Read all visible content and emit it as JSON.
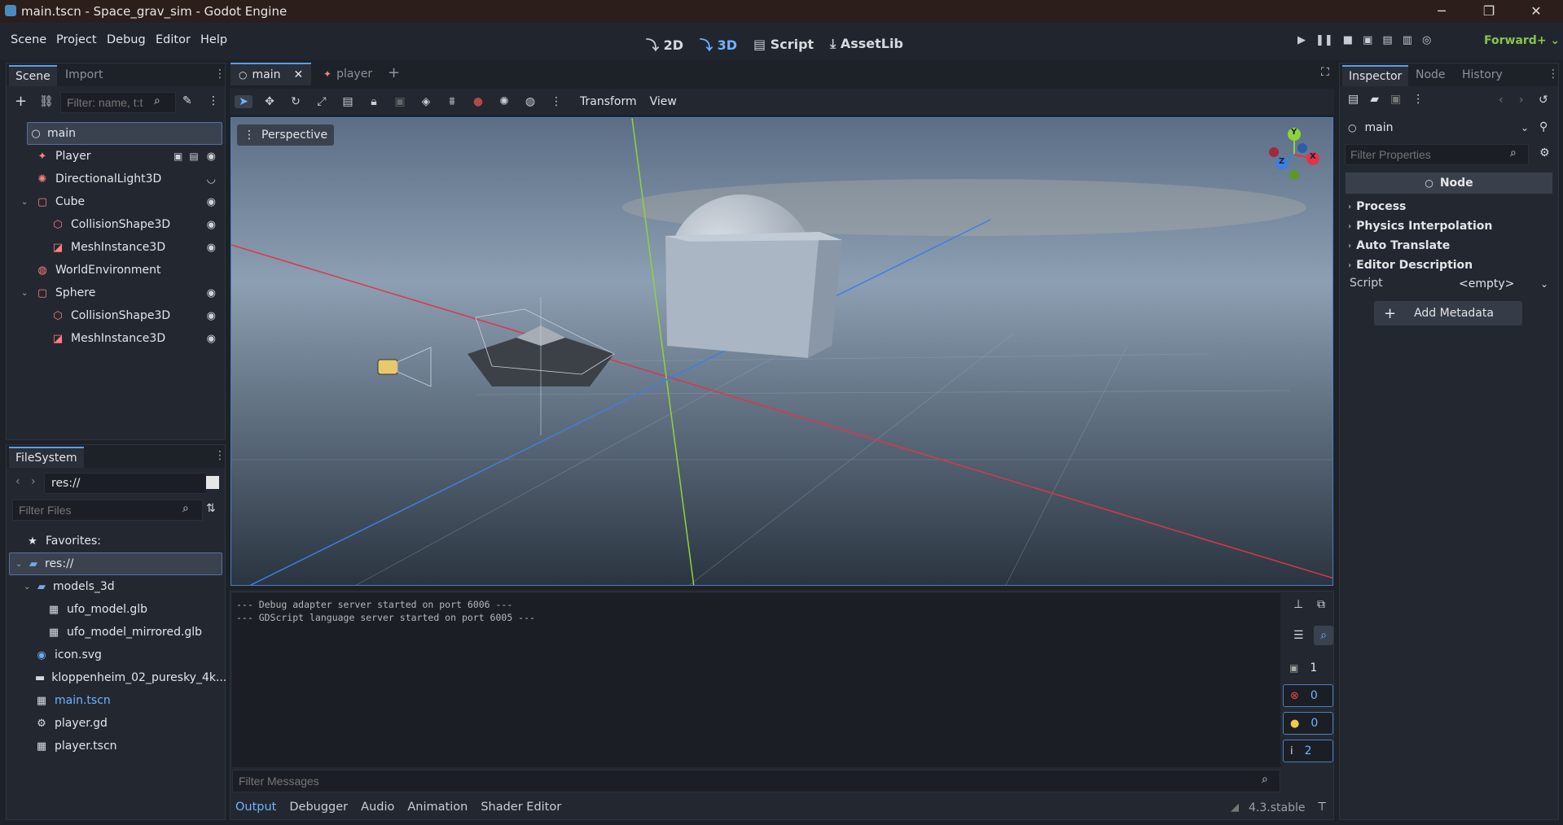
{
  "window": {
    "title": "main.tscn - Space_grav_sim - Godot Engine",
    "controls": [
      "─",
      "❐",
      "✕"
    ]
  },
  "menubar": {
    "menus": [
      "Scene",
      "Project",
      "Debug",
      "Editor",
      "Help"
    ],
    "modes": {
      "m2d": "2D",
      "m3d": "3D",
      "script": "Script",
      "assetlib": "AssetLib"
    },
    "renderer": "Forward+"
  },
  "scene_dock": {
    "tabs": {
      "scene": "Scene",
      "import": "Import"
    },
    "filter_placeholder": "Filter: name, t:t",
    "nodes": [
      {
        "label": "main",
        "icon": "○",
        "color": "#e0e0e0",
        "indent": 0,
        "expanded": true,
        "selected": true
      },
      {
        "label": "Player",
        "icon": "✦",
        "color": "#fc7f7f",
        "indent": 1
      },
      {
        "label": "DirectionalLight3D",
        "icon": "✺",
        "color": "#fc7f7f",
        "indent": 1
      },
      {
        "label": "Cube",
        "icon": "▢",
        "color": "#fc7f7f",
        "indent": 1,
        "expanded": true
      },
      {
        "label": "CollisionShape3D",
        "icon": "⬡",
        "color": "#fc7f7f",
        "indent": 2
      },
      {
        "label": "MeshInstance3D",
        "icon": "◪",
        "color": "#fc7f7f",
        "indent": 2
      },
      {
        "label": "WorldEnvironment",
        "icon": "◍",
        "color": "#fc7f7f",
        "indent": 1
      },
      {
        "label": "Sphere",
        "icon": "▢",
        "color": "#fc7f7f",
        "indent": 1,
        "expanded": true
      },
      {
        "label": "CollisionShape3D",
        "icon": "⬡",
        "color": "#fc7f7f",
        "indent": 2
      },
      {
        "label": "MeshInstance3D",
        "icon": "◪",
        "color": "#fc7f7f",
        "indent": 2
      }
    ]
  },
  "filesystem": {
    "tab": "FileSystem",
    "path": "res://",
    "filter_placeholder": "Filter Files",
    "items": [
      {
        "label": "Favorites:",
        "icon": "★",
        "indent": 0
      },
      {
        "label": "res://",
        "icon": "▰",
        "indent": 0,
        "expanded": true,
        "selected": true
      },
      {
        "label": "models_3d",
        "icon": "▰",
        "indent": 1,
        "expanded": true
      },
      {
        "label": "ufo_model.glb",
        "icon": "▦",
        "indent": 2
      },
      {
        "label": "ufo_model_mirrored.glb",
        "icon": "▦",
        "indent": 2
      },
      {
        "label": "icon.svg",
        "icon": "◉",
        "indent": 1
      },
      {
        "label": "kloppenheim_02_puresky_4k...",
        "icon": "▬",
        "indent": 1
      },
      {
        "label": "main.tscn",
        "icon": "▦",
        "indent": 1,
        "highlight": true
      },
      {
        "label": "player.gd",
        "icon": "⚙",
        "indent": 1
      },
      {
        "label": "player.tscn",
        "icon": "▦",
        "indent": 1
      }
    ]
  },
  "editor_tabs": [
    {
      "label": "main",
      "active": true
    },
    {
      "label": "player"
    }
  ],
  "viewport": {
    "toolbar_menus": {
      "transform": "Transform",
      "view": "View"
    },
    "perspective_label": "Perspective",
    "gizmo": {
      "y": "Y",
      "x": "X",
      "z": "Z"
    }
  },
  "output": {
    "lines": [
      "--- Debug adapter server started on port 6006 ---",
      "--- GDScript language server started on port 6005 ---"
    ],
    "filter_placeholder": "Filter Messages",
    "counts": {
      "messages": "1",
      "errors": "0",
      "warnings": "0",
      "info": "2"
    }
  },
  "bottom_panel": {
    "tabs": [
      "Output",
      "Debugger",
      "Audio",
      "Animation",
      "Shader Editor"
    ],
    "version": "4.3.stable"
  },
  "inspector": {
    "tabs": {
      "inspector": "Inspector",
      "node": "Node",
      "history": "History"
    },
    "object": "main",
    "filter_placeholder": "Filter Properties",
    "class_header": "Node",
    "sections": [
      "Process",
      "Physics Interpolation",
      "Auto Translate",
      "Editor Description"
    ],
    "script_label": "Script",
    "script_value": "<empty>",
    "add_metadata": "Add Metadata"
  },
  "colors": {
    "accent": "#4fa3f7",
    "renderer": "#8ac44f",
    "error": "#e5484d",
    "warning": "#f2c94c"
  }
}
